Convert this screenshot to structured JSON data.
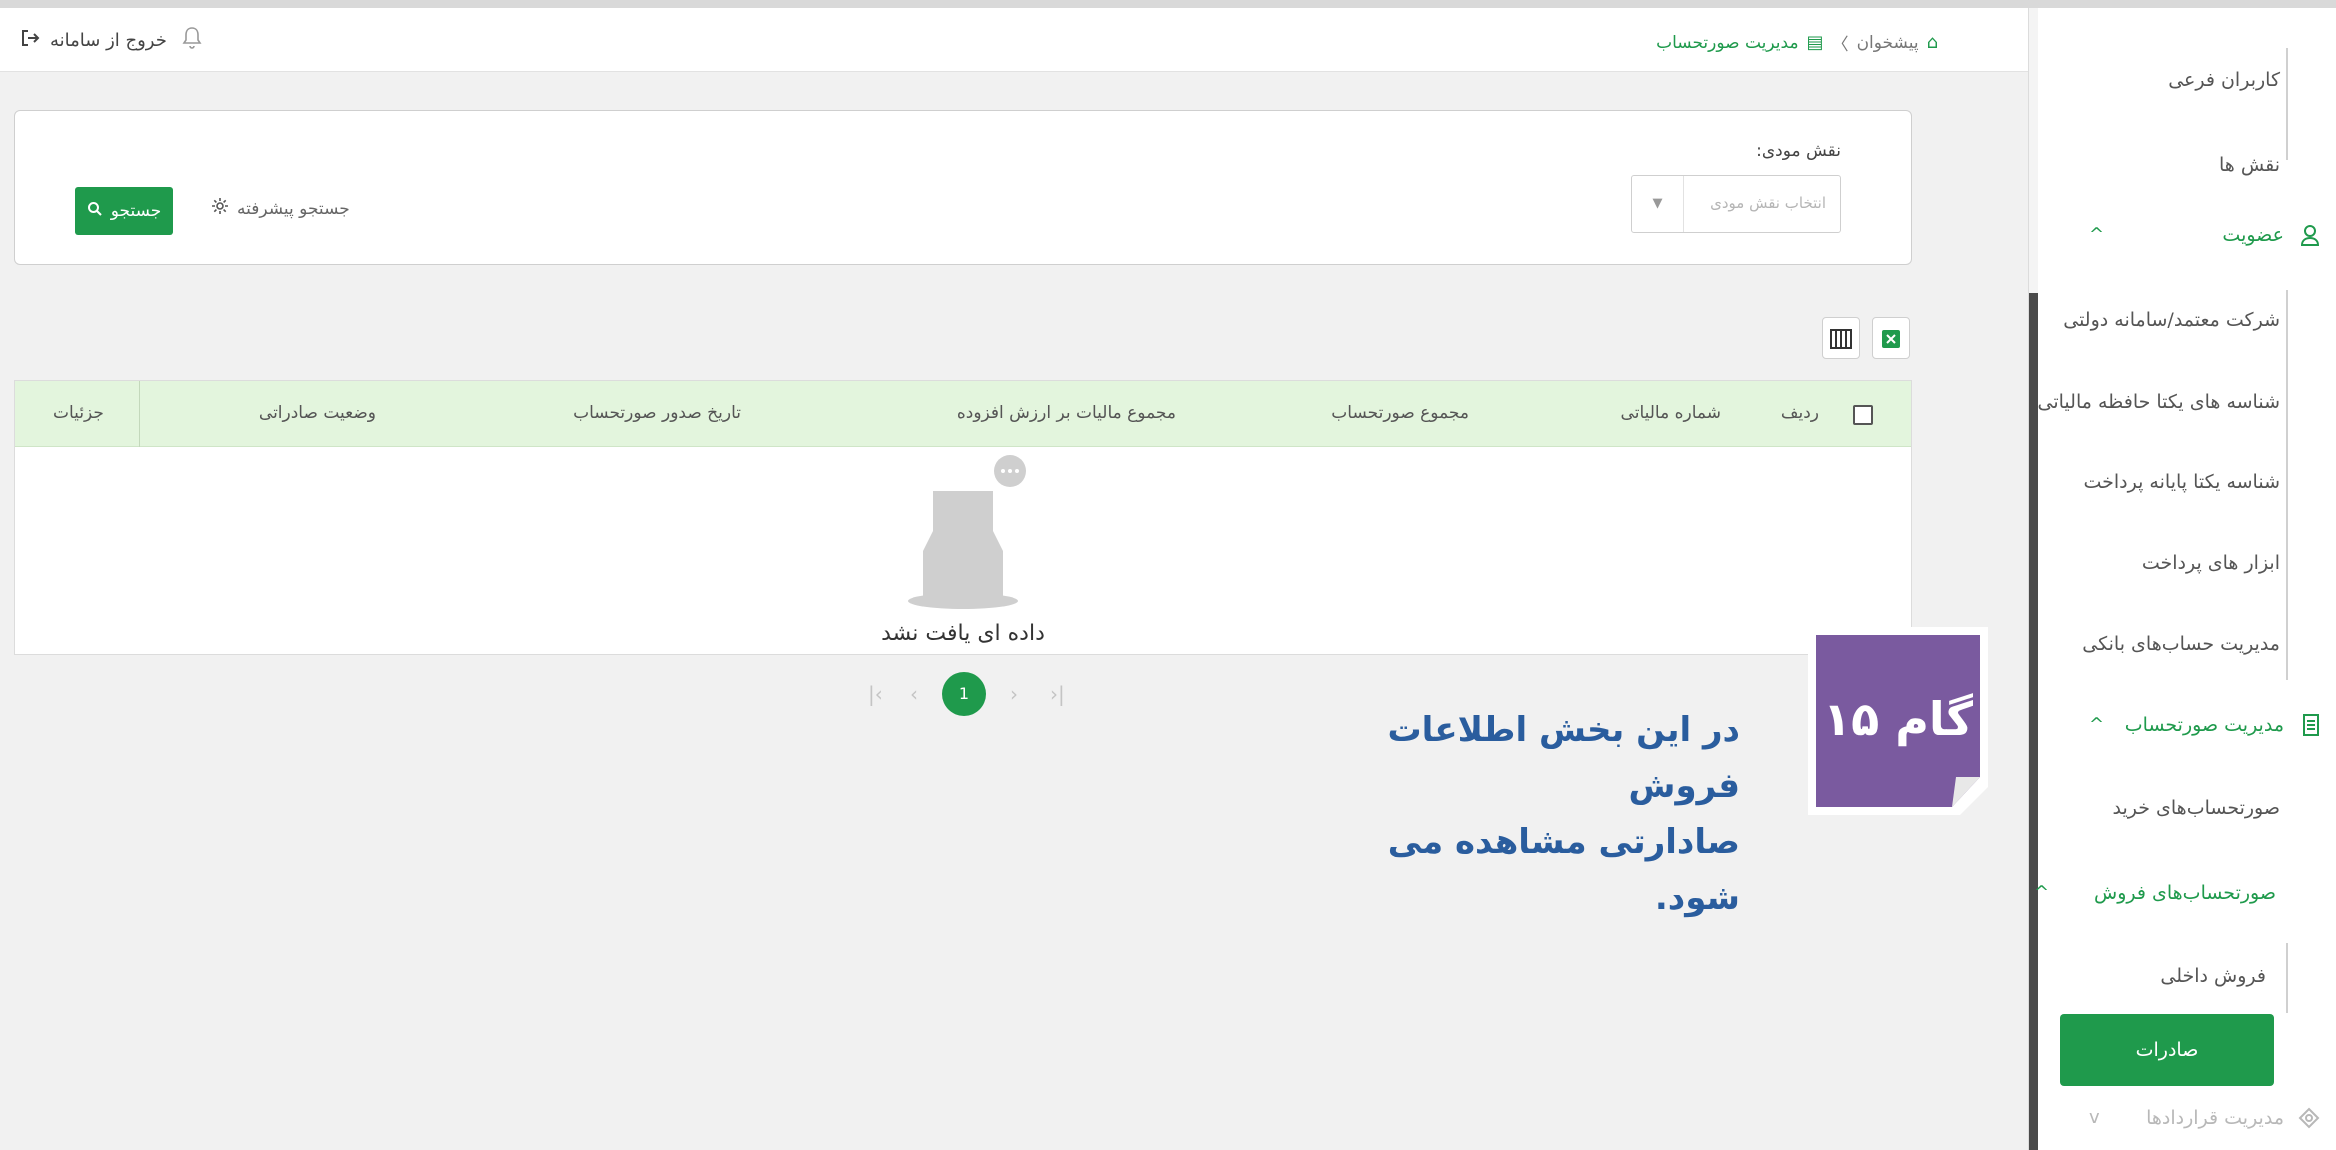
{
  "header": {
    "breadcrumb_home": "پیشخوان",
    "breadcrumb_sep": "〉",
    "breadcrumb_current": "مدیریت صورتحساب",
    "logout": "خروج از سامانه"
  },
  "sidebar": {
    "items_top": [
      "کاربران فرعی",
      "نقش ها"
    ],
    "group_membership": "عضویت",
    "membership_items": [
      "شرکت معتمد/سامانه دولتی",
      "شناسه های یکتا حافظه مالیاتی",
      "شناسه یکتا پایانه پرداخت",
      "ابزار های پرداخت",
      "مدیریت حساب‌های بانکی"
    ],
    "group_invoice": "مدیریت صورتحساب",
    "invoice_purchase": "صورتحساب‌های خرید",
    "invoice_sales": "صورتحساب‌های فروش",
    "sales_items": [
      "فروش داخلی",
      "صادرات"
    ],
    "group_contracts": "مدیریت قراردادها"
  },
  "search": {
    "role_label": "نقش مودی:",
    "role_placeholder": "انتخاب نقش مودی",
    "advanced": "جستجو پیشرفته",
    "button": "جستجو"
  },
  "table": {
    "columns": [
      "ردیف",
      "شماره مالیاتی",
      "مجموع صورتحساب",
      "مجموع مالیات بر ارزش افزوده",
      "تاریخ صدور صورتحساب",
      "وضعیت صادراتی",
      "جزئیات"
    ],
    "empty": "داده ای یافت نشد"
  },
  "pagination": {
    "current": "1",
    "first": "|‹",
    "prev": "‹",
    "next": "›",
    "last": "›|"
  },
  "annotation": {
    "step": "گام ۱۵",
    "line1": "در این بخش اطلاعات فروش",
    "line2": "صادارتی مشاهده می شود."
  },
  "colors": {
    "primary_green": "#1f9a4c",
    "table_header": "#e3f5dd",
    "step_badge": "#7a5a9f",
    "annotation_text": "#2a5d9e"
  }
}
